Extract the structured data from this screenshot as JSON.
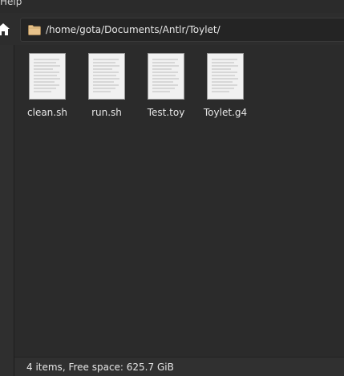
{
  "menubar": {
    "items": [
      {
        "label": "Help"
      }
    ]
  },
  "toolbar": {
    "home_icon": "home-icon",
    "path": "/home/gota/Documents/Antlr/Toylet/",
    "path_icon": "folder-icon"
  },
  "files": [
    {
      "name": "clean.sh",
      "icon": "text-file-icon"
    },
    {
      "name": "run.sh",
      "icon": "text-file-icon"
    },
    {
      "name": "Test.toy",
      "icon": "text-file-icon"
    },
    {
      "name": "Toylet.g4",
      "icon": "text-file-icon"
    }
  ],
  "status": {
    "text": "4 items, Free space: 625.7 GiB"
  },
  "colors": {
    "background": "#2b2b2b",
    "text": "#e6e6e6",
    "folder": "#e7c28b"
  }
}
